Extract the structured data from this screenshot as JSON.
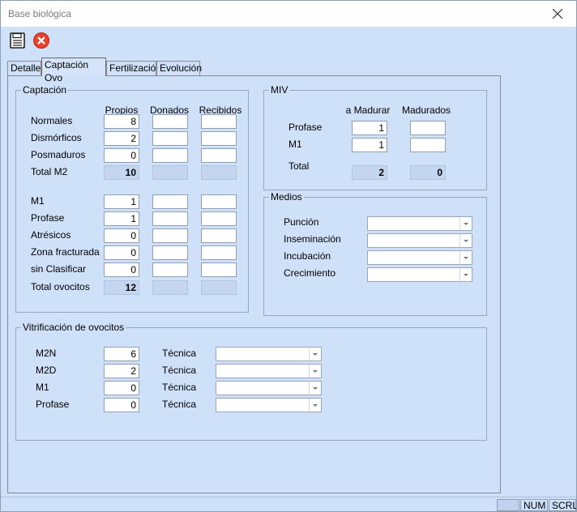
{
  "window": {
    "title": "Base biológica"
  },
  "toolbar": {
    "save_icon": "save-icon",
    "cancel_icon": "cancel-icon"
  },
  "tabs": [
    "Detalle",
    "Captación Ovo",
    "Fertilización",
    "Evolución"
  ],
  "captacion": {
    "title": "Captación",
    "headers": [
      "Propios",
      "Donados",
      "Recibidos"
    ],
    "rows_top": [
      {
        "label": "Normales",
        "propios": "8",
        "donados": "",
        "recibidos": ""
      },
      {
        "label": "Dismórficos",
        "propios": "2",
        "donados": "",
        "recibidos": ""
      },
      {
        "label": "Posmaduros",
        "propios": "0",
        "donados": "",
        "recibidos": ""
      }
    ],
    "total_m2": {
      "label": "Total M2",
      "propios": "10"
    },
    "rows_bottom": [
      {
        "label": "M1",
        "propios": "1",
        "donados": "",
        "recibidos": ""
      },
      {
        "label": "Profase",
        "propios": "1",
        "donados": "",
        "recibidos": ""
      },
      {
        "label": "Atrésicos",
        "propios": "0",
        "donados": "",
        "recibidos": ""
      },
      {
        "label": "Zona fracturada",
        "propios": "0",
        "donados": "",
        "recibidos": ""
      },
      {
        "label": "sin Clasificar",
        "propios": "0",
        "donados": "",
        "recibidos": ""
      }
    ],
    "total_ovocitos": {
      "label": "Total ovocitos",
      "propios": "12"
    }
  },
  "miv": {
    "title": "MIV",
    "headers": [
      "a Madurar",
      "Madurados"
    ],
    "rows": [
      {
        "label": "Profase",
        "a_madurar": "1",
        "madurados": ""
      },
      {
        "label": "M1",
        "a_madurar": "1",
        "madurados": ""
      }
    ],
    "total": {
      "label": "Total",
      "a_madurar": "2",
      "madurados": "0"
    }
  },
  "medios": {
    "title": "Medios",
    "rows": [
      {
        "label": "Punción",
        "value": ""
      },
      {
        "label": "Inseminación",
        "value": ""
      },
      {
        "label": "Incubación",
        "value": ""
      },
      {
        "label": "Crecimiento",
        "value": ""
      }
    ]
  },
  "vitrificacion": {
    "title": "Vitrificación de ovocitos",
    "tecnica_label": "Técnica",
    "rows": [
      {
        "label": "M2N",
        "value": "6",
        "tecnica": ""
      },
      {
        "label": "M2D",
        "value": "2",
        "tecnica": ""
      },
      {
        "label": "M1",
        "value": "0",
        "tecnica": ""
      },
      {
        "label": "Profase",
        "value": "0",
        "tecnica": ""
      }
    ]
  },
  "statusbar": {
    "num": "NUM",
    "scrl": "SCRL"
  },
  "colors": {
    "background": "#cfe0f9",
    "cancel_red": "#e8412c"
  }
}
